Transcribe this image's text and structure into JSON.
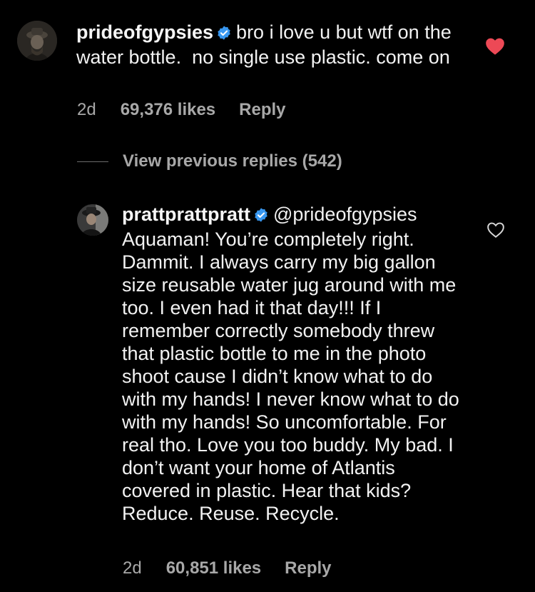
{
  "comment1": {
    "username": "prideofgypsies",
    "text": "bro i love u but wtf on the water bottle.  no single use plastic. come on",
    "time": "2d",
    "likes": "69,376 likes",
    "reply_label": "Reply",
    "liked": true
  },
  "view_previous": {
    "label": "View previous replies (542)"
  },
  "comment2": {
    "username": "prattprattpratt",
    "mention": "@prideofgypsies",
    "text": "Aquaman! You’re completely right. Dammit. I always carry my big gallon size reusable water jug around with me too. I even had it that day!!! If I remember correctly somebody threw that plastic bottle to me in the photo shoot cause I didn’t know what to do with my hands! I never know what to do with my hands! So uncomfortable. For real tho. Love you too buddy. My bad. I don’t want your home of Atlantis covered in plastic. Hear that kids? Reduce. Reuse. Recycle.",
    "time": "2d",
    "likes": "60,851 likes",
    "reply_label": "Reply",
    "liked": false
  },
  "colors": {
    "background": "#000000",
    "text": "#f2f2f2",
    "secondary": "#a8a8a8",
    "verified": "#3897f0",
    "heart": "#ed4956"
  },
  "icons": {
    "verified": "verified-badge-icon",
    "liked_heart": "heart-filled-icon",
    "unliked_heart": "heart-outline-icon"
  }
}
